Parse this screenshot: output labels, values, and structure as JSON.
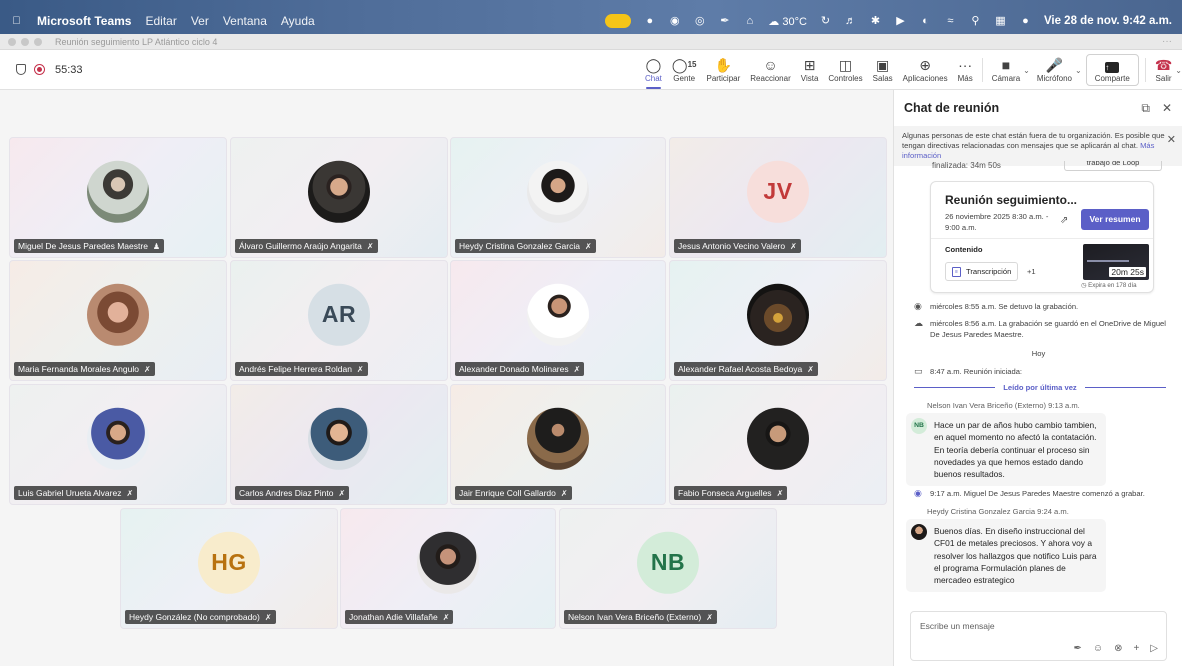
{
  "menubar": {
    "app": "Microsoft Teams",
    "items": [
      "Editar",
      "Ver",
      "Ventana",
      "Ayuda"
    ],
    "weather": "30°C",
    "datetime": "Vie 28 de nov. 9:42 a.m."
  },
  "window": {
    "title": "Reunión seguimiento LP Atlántico ciclo 4"
  },
  "toolbar": {
    "timer": "55:33",
    "chat": "Chat",
    "people": "Gente",
    "people_count": "15",
    "raise": "Participar",
    "react": "Reaccionar",
    "view": "Vista",
    "controls": "Controles",
    "rooms": "Salas",
    "apps": "Aplicaciones",
    "more": "Más",
    "camera": "Cámara",
    "mic": "Micrófono",
    "share": "Comparte",
    "leave": "Salir"
  },
  "participants": [
    {
      "name": "Miguel De Jesus Paredes Maestre",
      "type": "photo"
    },
    {
      "name": "Álvaro Guillermo Araújo Angarita",
      "type": "photo"
    },
    {
      "name": "Heydy Cristina Gonzalez Garcia",
      "type": "photo"
    },
    {
      "name": "Jesus Antonio Vecino Valero",
      "type": "initials",
      "initials": "JV",
      "color": "#c23a3a",
      "bg": "#f7dedb"
    },
    {
      "name": "Maria Fernanda Morales Angulo",
      "type": "photo"
    },
    {
      "name": "Andrés Felipe Herrera Roldan",
      "type": "initials",
      "initials": "AR",
      "color": "#3a4a58",
      "bg": "#d6dfe5"
    },
    {
      "name": "Alexander Donado Molinares",
      "type": "photo"
    },
    {
      "name": "Alexander Rafael Acosta Bedoya",
      "type": "photo"
    },
    {
      "name": "Luis Gabriel Urueta Alvarez",
      "type": "photo"
    },
    {
      "name": "Carlos Andres Diaz Pinto",
      "type": "photo"
    },
    {
      "name": "Jair Enrique Coll Gallardo",
      "type": "photo"
    },
    {
      "name": "Fabio Fonseca Arguelles",
      "type": "photo"
    },
    {
      "name": "Heydy González (No comprobado)",
      "type": "initials",
      "initials": "HG",
      "color": "#b8720f",
      "bg": "#f8eccc"
    },
    {
      "name": "Jonathan Adie Villafañe",
      "type": "photo"
    },
    {
      "name": "Nelson Ivan Vera Briceño (Externo)",
      "type": "initials",
      "initials": "NB",
      "color": "#23744a",
      "bg": "#d3ecd9"
    }
  ],
  "chat": {
    "title": "Chat de reunión",
    "banner_text": "Algunas personas de este chat están fuera de tu organización. Es posible que tengan directivas relacionadas con mensajes que se aplicarán al chat.",
    "banner_link": "Más información",
    "cut_left": "finalizada: 34m 50s",
    "cut_right": "trabajo de Loop",
    "card": {
      "title": "Reunión seguimiento...",
      "date": "26 noviembre 2025 8:30 a.m. - 9:00 a.m.",
      "button": "Ver resumen",
      "content_label": "Contenido",
      "transcript": "Transcripción",
      "plus": "+1",
      "duration": "20m 25s",
      "expires": "Expira en 178 día"
    },
    "sys1": "miércoles 8:55 a.m.   Se detuvo la grabación.",
    "sys2": "miércoles 8:56 a.m.   La grabación se guardó en el OneDrive de Miguel De Jesus Paredes Maestre.",
    "today": "Hoy",
    "sys3": "8:47 a.m.   Reunión iniciada:",
    "last_read": "Leído por última vez",
    "m1_sender": "Nelson Ivan Vera Briceño (Externo)  9:13 a.m.",
    "m1_initials": "NB",
    "m1_text": "Hace un par de años hubo cambio tambien, en aquel momento no afectó la contatación. En teoría debería continuar el proceso sin novedades ya que hemos estado dando buenos resultados.",
    "sys4": "9:17 a.m.   Miguel De Jesus Paredes Maestre comenzó a grabar.",
    "m2_sender": "Heydy Cristina Gonzalez Garcia  9:24 a.m.",
    "m2_text": "Buenos días. En diseño instruccional del CF01 de metales preciosos. Y ahora voy a resolver los hallazgos que notifico Luis para el programa Formulación planes de mercadeo estrategico",
    "composer_placeholder": "Escribe un mensaje"
  }
}
